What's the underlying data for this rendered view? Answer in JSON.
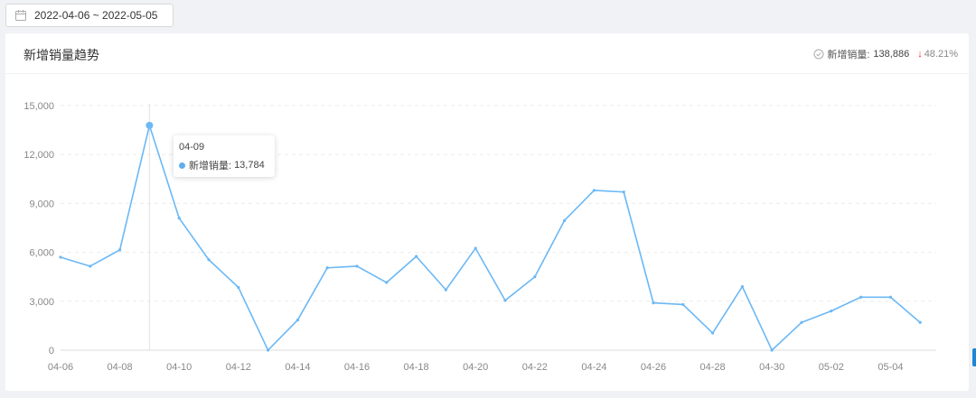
{
  "date_range": {
    "value": "2022-04-06 ~ 2022-05-05"
  },
  "card": {
    "title": "新增销量趋势",
    "summary_label": "新增销量:",
    "summary_value": "138,886",
    "summary_change": "48.21%",
    "change_direction": "down"
  },
  "tooltip": {
    "date": "04-09",
    "label": "新增销量:",
    "value": "13,784"
  },
  "colors": {
    "line": "#6bb8f5",
    "accent_down": "#f5222d"
  },
  "chart_data": {
    "type": "line",
    "ylim": [
      0,
      15000
    ],
    "yticks": [
      "0",
      "3,000",
      "6,000",
      "9,000",
      "12,000",
      "15,000"
    ],
    "ytick_values": [
      0,
      3000,
      6000,
      9000,
      12000,
      15000
    ],
    "grid": true,
    "x": [
      "04-06",
      "04-07",
      "04-08",
      "04-09",
      "04-10",
      "04-11",
      "04-12",
      "04-13",
      "04-14",
      "04-15",
      "04-16",
      "04-17",
      "04-18",
      "04-19",
      "04-20",
      "04-21",
      "04-22",
      "04-23",
      "04-24",
      "04-25",
      "04-26",
      "04-27",
      "04-28",
      "04-29",
      "04-30",
      "05-01",
      "05-02",
      "05-03",
      "05-04",
      "05-05"
    ],
    "xtick_labels": [
      "04-06",
      "04-08",
      "04-10",
      "04-12",
      "04-14",
      "04-16",
      "04-18",
      "04-20",
      "04-22",
      "04-24",
      "04-26",
      "04-28",
      "04-30",
      "05-02",
      "05-04"
    ],
    "series": [
      {
        "name": "新增销量",
        "values": [
          5700,
          5150,
          6150,
          13784,
          8100,
          5550,
          3850,
          0,
          1850,
          5050,
          5150,
          4150,
          5750,
          3700,
          6250,
          3050,
          4500,
          7950,
          9800,
          9700,
          2900,
          2800,
          1050,
          3900,
          0,
          1700,
          2400,
          3250,
          3250,
          1700
        ]
      }
    ],
    "highlight_index": 3
  }
}
